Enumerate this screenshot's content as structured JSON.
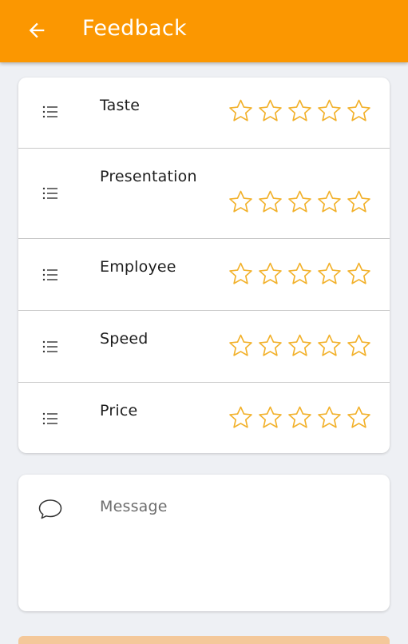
{
  "appbar": {
    "title": "Feedback",
    "back_icon": "arrow-left-icon",
    "color": "#fb9701"
  },
  "ratings": {
    "star_color": "#f2b12b",
    "max_stars": 5,
    "items": [
      {
        "label": "Taste",
        "icon": "list-icon",
        "rating": 0
      },
      {
        "label": "Presentation",
        "icon": "list-icon",
        "rating": 0
      },
      {
        "label": "Employee",
        "icon": "list-icon",
        "rating": 0
      },
      {
        "label": "Speed",
        "icon": "list-icon",
        "rating": 0
      },
      {
        "label": "Price",
        "icon": "list-icon",
        "rating": 0
      }
    ]
  },
  "message": {
    "icon": "chat-bubble-icon",
    "placeholder": "Message",
    "value": ""
  }
}
